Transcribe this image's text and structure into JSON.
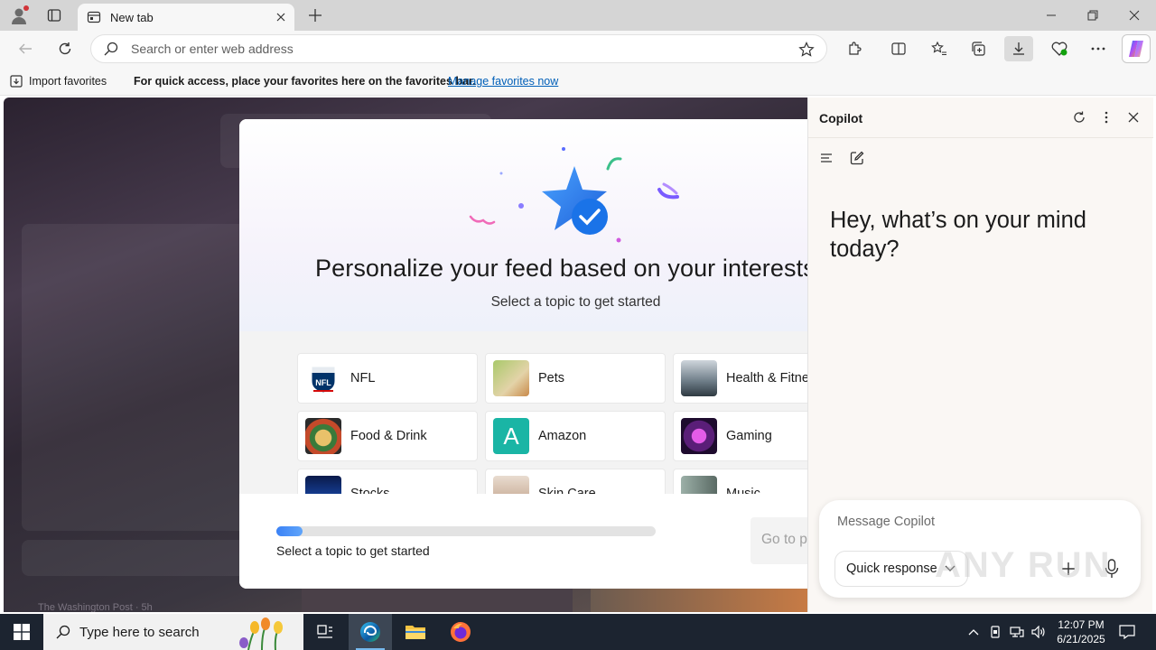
{
  "browser": {
    "tab_title": "New tab",
    "address_placeholder": "Search or enter web address"
  },
  "favorites_bar": {
    "import_label": "Import favorites",
    "message": "For quick access, place your favorites here on the favorites bar.",
    "manage_link": "Manage favorites now"
  },
  "background": {
    "source": "The Washington Post · 5h"
  },
  "modal": {
    "title": "Personalize your feed based on your interests",
    "subtitle": "Select a topic to get started",
    "topics": [
      {
        "label": "NFL",
        "icon": "nfl-logo"
      },
      {
        "label": "Pets",
        "icon": "pets-image"
      },
      {
        "label": "Health & Fitness",
        "icon": "fitness-image"
      },
      {
        "label": "Food & Drink",
        "icon": "food-image"
      },
      {
        "label": "Amazon",
        "icon": "amazon-letter-a"
      },
      {
        "label": "Gaming",
        "icon": "gaming-image"
      },
      {
        "label": "Stocks",
        "icon": "stocks-image"
      },
      {
        "label": "Skin Care",
        "icon": "skincare-image"
      },
      {
        "label": "Music",
        "icon": "music-image"
      }
    ],
    "progress": 0.07,
    "footer_text": "Select a topic to get started",
    "next_button": "Go to p"
  },
  "copilot": {
    "title": "Copilot",
    "greeting": "Hey, what’s on your mind today?",
    "message_placeholder": "Message Copilot",
    "mode_label": "Quick response"
  },
  "watermark": "ANY RUN",
  "taskbar": {
    "search_placeholder": "Type here to search",
    "time": "12:07 PM",
    "date": "6/21/2025"
  },
  "colors": {
    "link": "#005fb8",
    "taskbar": "#1c2430",
    "amazon_tile": "#1ab5a5",
    "progress": "#3b82f6"
  }
}
